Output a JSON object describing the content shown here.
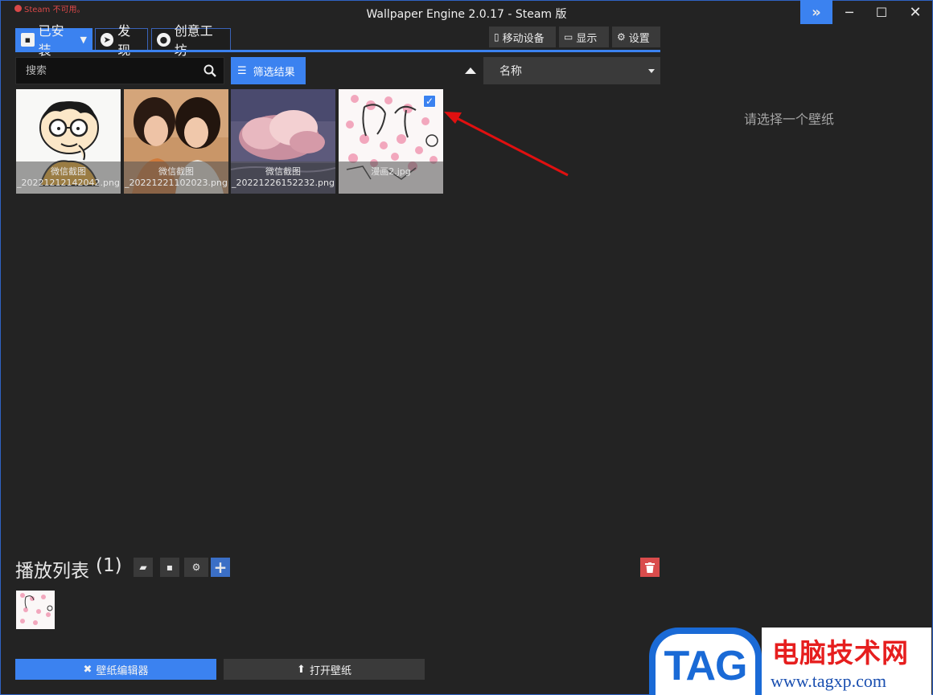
{
  "titlebar": {
    "steam_status": "Steam 不可用。",
    "title": "Wallpaper Engine 2.0.17 - Steam 版",
    "expand_glyph": "»",
    "minimize_glyph": "─",
    "maximize_glyph": "☐",
    "close_glyph": "✕"
  },
  "nav": {
    "tabs": [
      {
        "label": "已安装",
        "icon": "save-icon"
      },
      {
        "label": "发现",
        "icon": "compass-icon"
      },
      {
        "label": "创意工坊",
        "icon": "steam-icon"
      }
    ],
    "mobile_label": "移动设备",
    "display_label": "显示",
    "settings_label": "设置"
  },
  "search": {
    "placeholder": "搜索"
  },
  "filter_label": "筛选结果",
  "sort": {
    "selected": "名称",
    "direction": "ascending"
  },
  "wallpapers": [
    {
      "line1": "微信截图",
      "line2": "_20221212142042.png"
    },
    {
      "line1": "微信截图",
      "line2": "_20221221102023.png"
    },
    {
      "line1": "微信截图",
      "line2": "_20221226152232.png"
    },
    {
      "line1": "",
      "line2": "漫画2.jpg",
      "selected": true
    }
  ],
  "details": {
    "empty_text": "请选择一个壁纸"
  },
  "playlist": {
    "title": "播放列表",
    "count": "(1)"
  },
  "bottom": {
    "editor_label": "壁纸编辑器",
    "open_label": "打开壁纸"
  },
  "watermark": {
    "logo": "TAG",
    "name": "电脑技术网",
    "url": "www.tagxp.com"
  },
  "colors": {
    "accent": "#3b82f0",
    "background": "#232323",
    "danger": "#d94c4c",
    "arrow": "#e01010"
  }
}
